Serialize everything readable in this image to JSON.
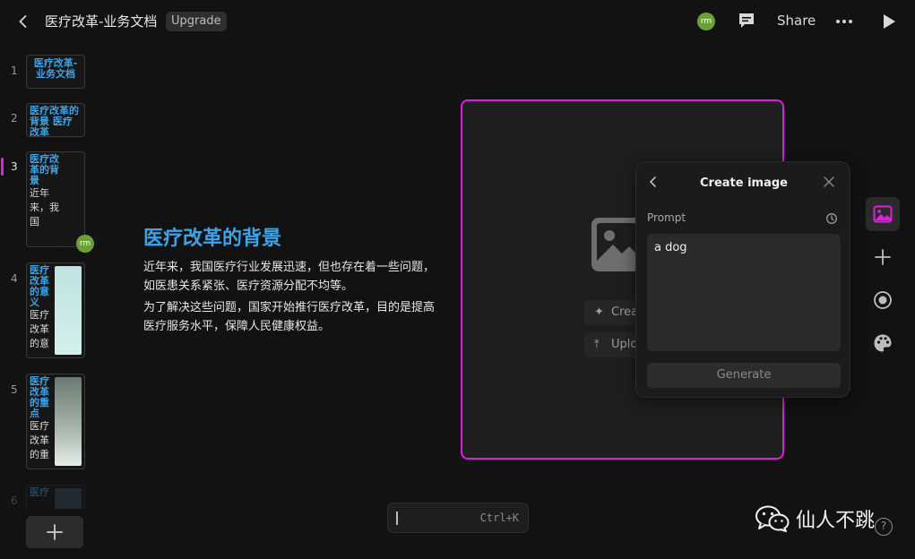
{
  "header": {
    "title": "医疗改革-业务文档",
    "upgrade_label": "Upgrade",
    "avatar_initials": "rm",
    "share_label": "Share"
  },
  "slides": [
    {
      "number": "1",
      "title": "医疗改革-业务文档",
      "body": ""
    },
    {
      "number": "2",
      "title": "医疗改革的背景 医疗改革",
      "body": ""
    },
    {
      "number": "3",
      "title": "医疗改革的背景",
      "body": "近年来，我国"
    },
    {
      "number": "4",
      "title": "医疗改革的意义",
      "body": "医疗改革的意"
    },
    {
      "number": "5",
      "title": "医疗改革的重点",
      "body": "医疗改革的重"
    },
    {
      "number": "6",
      "title": "医疗",
      "body": ""
    }
  ],
  "slide_avatar": "rm",
  "canvas": {
    "heading": "医疗改革的背景",
    "paragraph1": "近年来，我国医疗行业发展迅速，但也存在着一些问题，如医患关系紧张、医疗资源分配不均等。",
    "paragraph2": "为了解决这些问题，国家开始推行医疗改革，目的是提高医疗服务水平，保障人民健康权益。"
  },
  "placeholder": {
    "create_label": "Crea",
    "upload_label": "Uplo"
  },
  "create_image": {
    "title": "Create image",
    "prompt_label": "Prompt",
    "prompt_value": "a dog",
    "generate_label": "Generate"
  },
  "command_bar": {
    "shortcut": "Ctrl+K"
  },
  "watermark": {
    "text": "仙人不跳"
  },
  "help_label": "?",
  "colors": {
    "accent": "#e21ce2",
    "title_blue": "#3aa4ea",
    "avatar_green": "#6aa036"
  },
  "icons": [
    "back-arrow-icon",
    "comment-icon",
    "more-icon",
    "play-icon",
    "image-icon",
    "plus-icon",
    "record-icon",
    "palette-icon",
    "history-icon",
    "close-icon",
    "sparkle-icon",
    "upload-icon",
    "wechat-icon"
  ]
}
